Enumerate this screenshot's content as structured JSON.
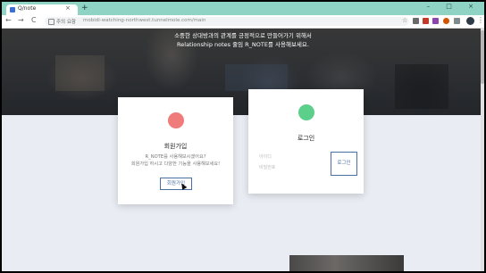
{
  "browser": {
    "tab_title": "Q/note",
    "tab_close": "×",
    "new_tab": "+",
    "window_buttons": "– □ ×",
    "back": "←",
    "forward": "→",
    "reload": "C",
    "site_info": "주의 요함",
    "url": "mobidi-watching-northwest.tunnelmole.com/main",
    "bookmark": "☆",
    "menu": "⋮"
  },
  "hero": {
    "line1": "소중한 상대방과의 관계를 긍정적으로 만들어가기 위해서",
    "line2": "Relationship notes 줄임 R_NOTE를 사용해보세요."
  },
  "signup_card": {
    "title": "회원가입",
    "desc1": "R_NOTE를 사용해보시겠어요?",
    "desc2": "회원가입 하시고 다양한 기능을 사용해보세요!",
    "button": "회원가입",
    "icon_color": "#f07b7b"
  },
  "login_card": {
    "title": "로그인",
    "id_placeholder": "아이디",
    "pw_placeholder": "비밀번호",
    "button": "로그인",
    "icon_color": "#5cd08a"
  }
}
